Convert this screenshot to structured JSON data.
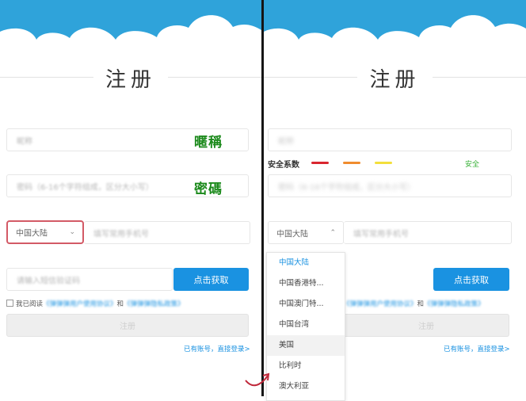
{
  "title": "注册",
  "annotations": {
    "nickname": "暱稱",
    "password": "密碼"
  },
  "form": {
    "nickname_placeholder": "昵称",
    "password_placeholder": "密码（6-16个字符组成，区分大小写）",
    "region_value": "中国大陆",
    "phone_placeholder": "填写常用手机号",
    "code_placeholder": "请输入短信验证码",
    "get_code_label": "点击获取",
    "agree_prefix": "我已阅读",
    "agree_link1": "《弹弹弹用户使用协议》",
    "agree_and": "和",
    "agree_link2": "《弹弹弹隐私政策》",
    "register_label": "注册",
    "login_link": "已有账号，直接登录>"
  },
  "strength": {
    "label": "安全系数",
    "safe_label": "安全",
    "colors": [
      "#d9262f",
      "#f08c2e",
      "#f3df3c"
    ]
  },
  "dropdown": {
    "options": [
      "中国大陆",
      "中国香港特...",
      "中国澳门特...",
      "中国台湾",
      "美国",
      "比利时",
      "澳大利亚"
    ],
    "selected_index": 0,
    "hover_index": 4
  },
  "colors": {
    "accent": "#1a92e1",
    "cloud": "#2fa3da",
    "highlight": "#d35a66",
    "annotation": "#1c8a1c"
  }
}
